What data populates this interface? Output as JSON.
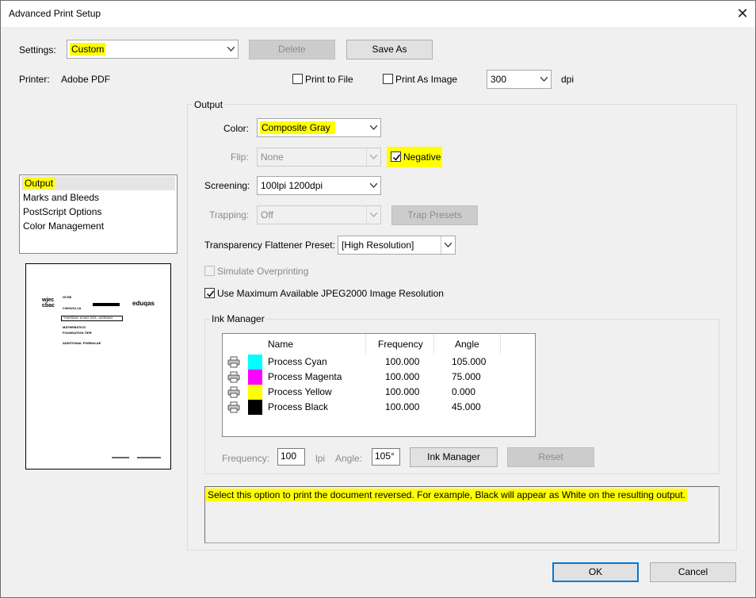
{
  "window": {
    "title": "Advanced Print Setup",
    "close_glyph": "✕"
  },
  "settings": {
    "label": "Settings:",
    "value": "Custom",
    "delete_label": "Delete",
    "save_as_label": "Save As"
  },
  "printer": {
    "label": "Printer:",
    "value": "Adobe PDF",
    "print_to_file": "Print to File",
    "print_as_image": "Print As Image",
    "dpi_value": "300",
    "dpi_unit": "dpi"
  },
  "sidebar": {
    "items": [
      {
        "label": "Output",
        "selected": true
      },
      {
        "label": "Marks and Bleeds",
        "selected": false
      },
      {
        "label": "PostScript Options",
        "selected": false
      },
      {
        "label": "Color Management",
        "selected": false
      }
    ]
  },
  "output": {
    "group_label": "Output",
    "color_label": "Color:",
    "color_value": "Composite Gray",
    "flip_label": "Flip:",
    "flip_value": "None",
    "negative_label": "Negative",
    "negative_checked": true,
    "screening_label": "Screening:",
    "screening_value": "100lpi 1200dpi",
    "trapping_label": "Trapping:",
    "trapping_value": "Off",
    "trap_presets_label": "Trap Presets",
    "flattener_label": "Transparency Flattener Preset:",
    "flattener_value": "[High Resolution]",
    "simulate_overprinting_label": "Simulate Overprinting",
    "jpeg2000_label": "Use Maximum Available JPEG2000 Image Resolution",
    "jpeg2000_checked": true
  },
  "ink_manager": {
    "group_label": "Ink Manager",
    "columns": [
      "Name",
      "Frequency",
      "Angle"
    ],
    "rows": [
      {
        "name": "Process Cyan",
        "frequency": "100.000",
        "angle": "105.000",
        "color": "#00ffff"
      },
      {
        "name": "Process Magenta",
        "frequency": "100.000",
        "angle": "75.000",
        "color": "#ff00ff"
      },
      {
        "name": "Process Yellow",
        "frequency": "100.000",
        "angle": "0.000",
        "color": "#ffff00"
      },
      {
        "name": "Process Black",
        "frequency": "100.000",
        "angle": "45.000",
        "color": "#000000"
      }
    ],
    "frequency_label": "Frequency:",
    "frequency_value": "100",
    "frequency_unit": "lpi",
    "angle_label": "Angle:",
    "angle_value": "105°",
    "ink_manager_button": "Ink Manager",
    "reset_button": "Reset"
  },
  "description": "Select this option to print the document reversed. For example, Black will appear as White on the resulting output.",
  "footer": {
    "ok_label": "OK",
    "cancel_label": "Cancel"
  },
  "preview": {
    "text_gcse": "GCSE",
    "text_code": "C300U10-1A",
    "text_date": "THURSDAY, 18 MAY 2023 – MORNING",
    "text_subject": "MATHEMATICS",
    "text_tier": "FOUNDATION TIER",
    "text_extra": "ADDITIONAL FORMULAE",
    "logo_left_1": "wjec",
    "logo_left_2": "cbac",
    "logo_right": "eduqas"
  },
  "colors": {
    "highlight": "#ffff00",
    "accent": "#0078d7"
  }
}
